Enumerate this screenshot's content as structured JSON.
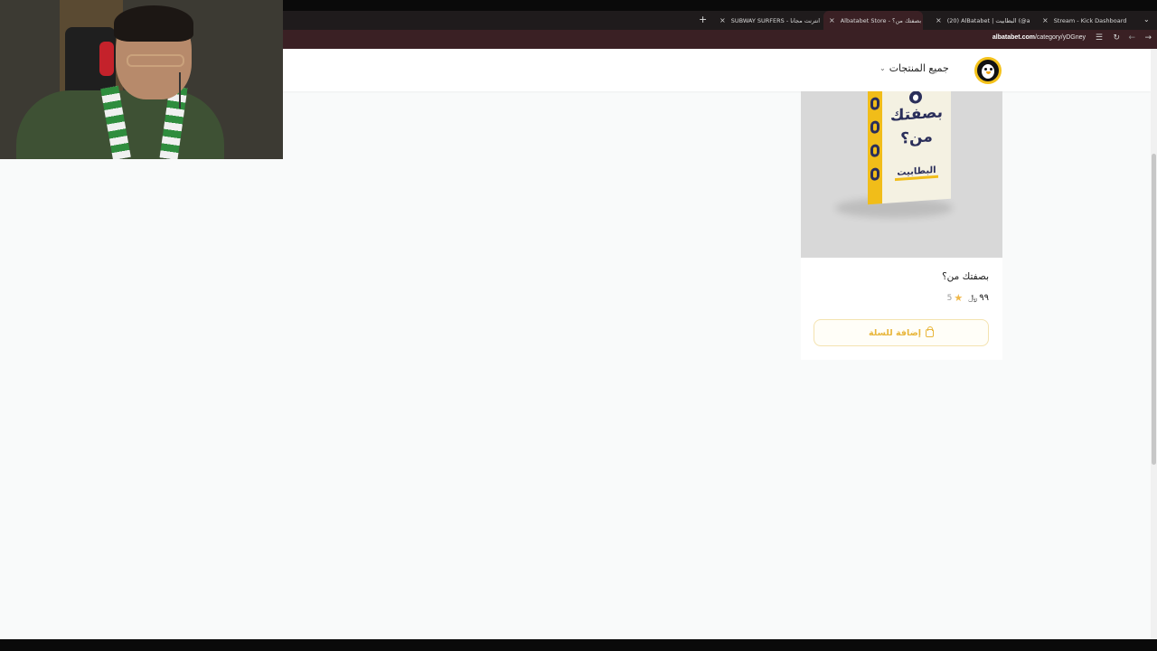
{
  "browser": {
    "tabs": [
      {
        "title": "Stream - Kick Dashboard",
        "favicon_color": "#53fc18"
      },
      {
        "title": "(20) AlBatabet | البطابيت (@albat",
        "favicon_color": "#ffffff"
      },
      {
        "title": "بصفتك من؟ - Albatabet Store",
        "favicon_color": "#f4c21b",
        "active": true
      },
      {
        "title": "انترنت مجانا - SUBWAY SURFERS",
        "favicon_color": "#4a90d9"
      }
    ],
    "url_domain": "albatabet.com",
    "url_path": "/category/yDGney"
  },
  "header": {
    "all_products_label": "جميع المنتجات"
  },
  "product": {
    "box_text_line1": "بصفتك",
    "box_text_line2": "من؟",
    "box_brand": "البطابيت",
    "name": "بصفتك من؟",
    "price": "٩٩",
    "currency_symbol": "﷼",
    "rating": "5",
    "add_to_cart_label": "إضافة للسلة"
  },
  "colors": {
    "accent": "#e8b63c",
    "brand_yellow": "#f4c21b",
    "browser_frame": "#3a2024"
  },
  "icons": {
    "new_tab": "plus-icon",
    "close_tab": "close-icon",
    "reload": "reload-icon",
    "back": "back-arrow-icon",
    "forward": "forward-arrow-icon",
    "site_settings": "tune-icon",
    "cart": "shopping-bag-icon",
    "star": "star-icon"
  }
}
